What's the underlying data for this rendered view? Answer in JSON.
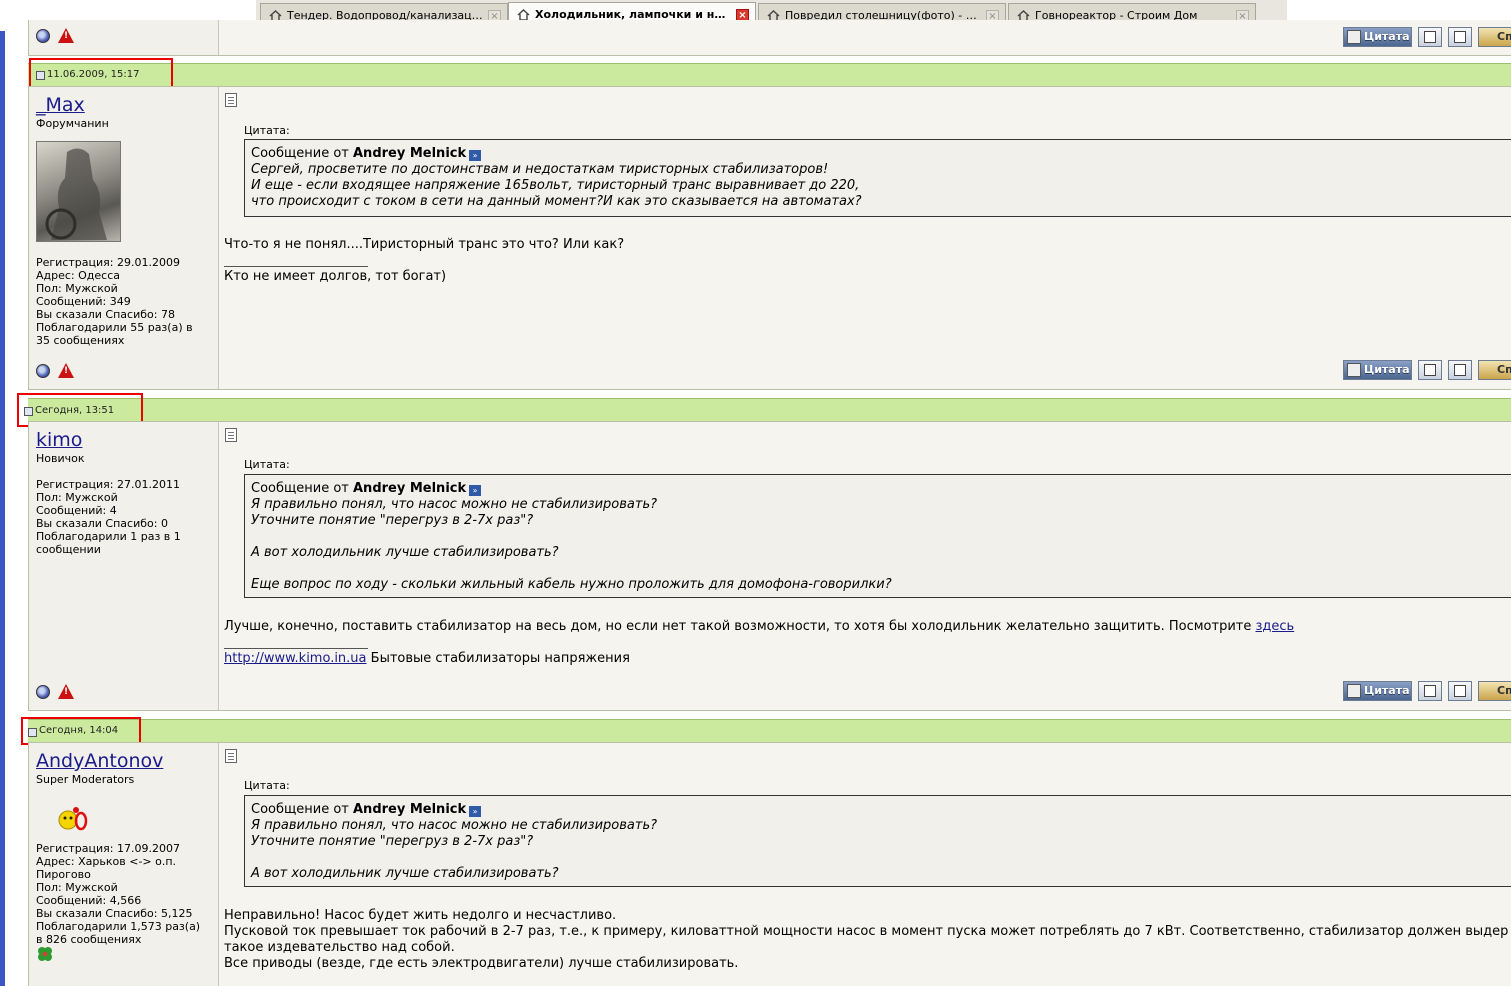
{
  "tabs": [
    {
      "label": "Тендер. Водопровод/канализация п..."
    },
    {
      "label": "Холодильник, лампочки и насос ..."
    },
    {
      "label": "Повредил столешницу(фото) - Строи..."
    },
    {
      "label": "Говнореактор - Строим Дом"
    }
  ],
  "tab_close_glyph": "×",
  "new_tab_glyph": "+",
  "buttons": {
    "cite_label": "Цитата",
    "thanks_label": "Сп"
  },
  "quote_label": "Цитата:",
  "quote_from_prefix": "Сообщение от",
  "quote_goto_glyph": "»",
  "posts": [
    {
      "date": "11.06.2009, 15:17",
      "username": "_Max",
      "user_title": "Форумчанин",
      "info": [
        "Регистрация: 29.01.2009",
        "Адрес: Одесса",
        "Пол: Мужской",
        "Сообщений: 349",
        "Вы сказали Спасибо: 78",
        "Поблагодарили 55 раз(а) в 35 сообщениях"
      ],
      "quote_author": "Andrey Melnick",
      "quote_lines": [
        "Сергей, просветите по достоинствам и недостаткам тиристорных стабилизаторов!",
        "И еще - если входящее напряжение 165вольт, тиристорный транс выравнивает до 220,",
        "что происходит с током в сети на данный момент?И как это сказывается на автоматах?"
      ],
      "body": "Что-то я не понял....Тиристорный транс это что? Или как?",
      "signature": "Кто не имеет долгов, тот богат)"
    },
    {
      "date": "Сегодня, 13:51",
      "username": "kimo",
      "user_title": "Новичок",
      "info": [
        "Регистрация: 27.01.2011",
        "Пол: Мужской",
        "Сообщений: 4",
        "Вы сказали Спасибо: 0",
        "Поблагодарили 1 раз в 1 сообщении"
      ],
      "quote_author": "Andrey Melnick",
      "quote_lines": [
        "Я правильно понял, что насос можно не стабилизировать?",
        "Уточните понятие \"перегруз в 2-7х раз\"?",
        "",
        "А вот холодильник лучше стабилизировать?",
        "",
        "Еще вопрос по ходу - скольки жильный кабель нужно проложить для домофона-говорилки?"
      ],
      "body": "Лучше, конечно, поставить стабилизатор на весь дом, но если нет такой возможности, то хотя бы холодильник желательно защитить. Посмотрите",
      "body_link": "здесь",
      "sig_link": "http://www.kimo.in.ua",
      "signature": "Бытовые стабилизаторы напряжения"
    },
    {
      "date": "Сегодня, 14:04",
      "username": "AndyAntonov",
      "user_title": "Super Moderators",
      "info": [
        "Регистрация: 17.09.2007",
        "Адрес: Харьков <-> о.п. Пирогово",
        "Пол: Мужской",
        "Сообщений: 4,566",
        "Вы сказали Спасибо: 5,125",
        "Поблагодарили 1,573 раз(а) в 826 сообщениях"
      ],
      "quote_author": "Andrey Melnick",
      "quote_lines": [
        "Я правильно понял, что насос можно не стабилизировать?",
        "Уточните понятие \"перегруз в 2-7х раз\"?",
        "",
        "А вот холодильник лучше стабилизировать?"
      ],
      "body_lines": [
        "Неправильно! Насос будет жить недолго и несчастливо.",
        "Пусковой ток превышает ток рабочий в 2-7 раз, т.е., к примеру, киловаттной мощности насос в момент пуска может потреблять до 7 кВт. Соответственно, стабилизатор должен выдер",
        "такое издевательство над собой.",
        "Все приводы (везде, где есть электродвигатели) лучше стабилизировать."
      ]
    }
  ]
}
